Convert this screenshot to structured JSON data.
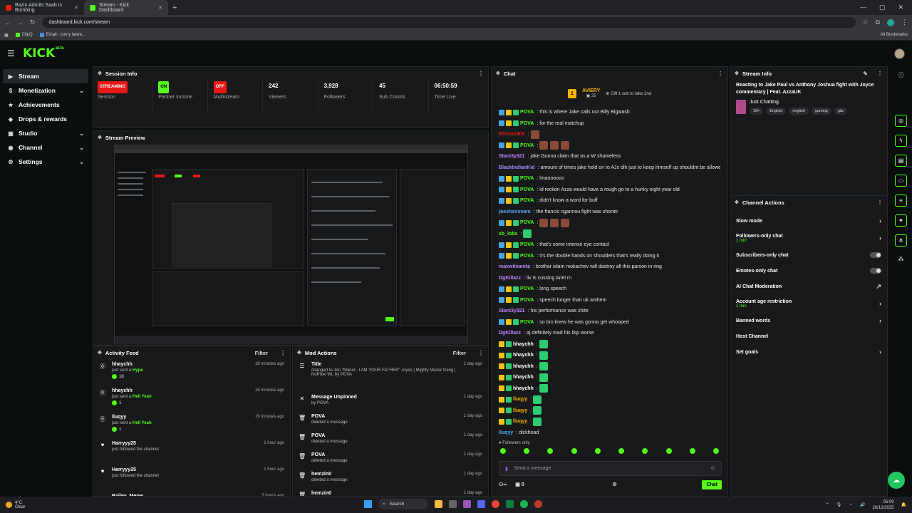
{
  "browser": {
    "tabs": [
      {
        "title": "Bazin Admits Saab Is Bombing",
        "color": "#e91916",
        "active": false
      },
      {
        "title": "Stream - Kick Dashboard",
        "color": "#53fc18",
        "active": true
      }
    ],
    "new_tab_label": "+",
    "url": "dashboard.kick.com/stream",
    "bookmarks": [
      {
        "label": "ClipQ",
        "color": "#53fc18"
      },
      {
        "label": "Email - jonny lawre...",
        "color": "#4a90d9"
      }
    ],
    "all_bookmarks_label": "All Bookmarks"
  },
  "header": {
    "logo": "KICK",
    "beta": "BETA"
  },
  "nav": {
    "items": [
      {
        "label": "Stream",
        "icon": "stream-icon",
        "glyph": "▶",
        "active": true,
        "chevron": false
      },
      {
        "label": "Monetization",
        "icon": "money-icon",
        "glyph": "$",
        "active": false,
        "chevron": true
      },
      {
        "label": "Achievements",
        "icon": "trophy-icon",
        "glyph": "★",
        "active": false,
        "chevron": false
      },
      {
        "label": "Drops & rewards",
        "icon": "gift-icon",
        "glyph": "◆",
        "active": false,
        "chevron": false
      },
      {
        "label": "Studio",
        "icon": "studio-icon",
        "glyph": "▣",
        "active": false,
        "chevron": true
      },
      {
        "label": "Channel",
        "icon": "channel-icon",
        "glyph": "◉",
        "active": false,
        "chevron": true
      },
      {
        "label": "Settings",
        "icon": "gear-icon",
        "glyph": "⚙",
        "active": false,
        "chevron": true
      }
    ]
  },
  "session": {
    "title": "Session Info",
    "cells": [
      {
        "value": "STREAMING",
        "label": "Session",
        "kind": "badge-red"
      },
      {
        "value": "ON",
        "label": "Partner Income",
        "kind": "badge-green"
      },
      {
        "value": "OFF",
        "label": "Multistream",
        "kind": "badge-red"
      },
      {
        "value": "242",
        "label": "Viewers",
        "kind": "text"
      },
      {
        "value": "3,928",
        "label": "Followers",
        "kind": "text"
      },
      {
        "value": "45",
        "label": "Sub Counts",
        "kind": "text"
      },
      {
        "value": "06:50:59",
        "label": "Time Live",
        "kind": "text"
      }
    ]
  },
  "preview": {
    "title": "Stream Preview"
  },
  "activity": {
    "title": "Activity Feed",
    "filter": "Filter",
    "items": [
      {
        "name": "hhaychh",
        "desc": "just sent a",
        "highlight": "Hype",
        "amount": "10",
        "time": "18 minutes ago",
        "icon": "kick-coin-icon",
        "glyph": "⓪"
      },
      {
        "name": "hhaychh",
        "desc": "just sent a",
        "highlight": "Hell Yeah",
        "amount": "1",
        "time": "18 minutes ago",
        "icon": "kick-coin-icon",
        "glyph": "⓪"
      },
      {
        "name": "lluqyy",
        "desc": "just sent a",
        "highlight": "Hell Yeah",
        "amount": "1",
        "time": "19 minutes ago",
        "icon": "kick-coin-icon",
        "glyph": "⓪"
      },
      {
        "name": "Harryyy25",
        "desc": "just followed the channel",
        "highlight": "",
        "amount": "",
        "time": "1 hour ago",
        "icon": "heart-icon",
        "glyph": "♥"
      },
      {
        "name": "Harryyy25",
        "desc": "just followed the channel",
        "highlight": "",
        "amount": "",
        "time": "1 hour ago",
        "icon": "heart-icon",
        "glyph": "♥"
      },
      {
        "name": "Bailey_Meow",
        "desc": "",
        "highlight": "",
        "amount": "",
        "time": "3 hours ago",
        "icon": "heart-icon",
        "glyph": "♥"
      }
    ]
  },
  "mod": {
    "title": "Mod Actions",
    "filter": "Filter",
    "items": [
      {
        "name": "Title",
        "desc": "changed to Jon \"Manor...I AM YOUR FATHER\" Joyce | Mighty Manor Gang | NoPixel WL by POVA",
        "time": "1 day ago",
        "icon": "title-icon",
        "glyph": "☰"
      },
      {
        "name": "Message Unpinned",
        "desc": "by POVA",
        "time": "1 day ago",
        "icon": "unpin-icon",
        "glyph": "✕"
      },
      {
        "name": "POVA",
        "desc": "deleted a message",
        "time": "1 day ago",
        "icon": "trash-icon",
        "glyph": "🗑"
      },
      {
        "name": "POVA",
        "desc": "deleted a message",
        "time": "1 day ago",
        "icon": "trash-icon",
        "glyph": "🗑"
      },
      {
        "name": "POVA",
        "desc": "deleted a message",
        "time": "1 day ago",
        "icon": "trash-icon",
        "glyph": "🗑"
      },
      {
        "name": "hemzin0",
        "desc": "deleted a message",
        "time": "1 day ago",
        "icon": "trash-icon",
        "glyph": "🗑"
      },
      {
        "name": "hemzin0",
        "desc": "",
        "time": "1 day ago",
        "icon": "trash-icon",
        "glyph": "🗑"
      }
    ]
  },
  "chat": {
    "title": "Chat",
    "pinned": {
      "rank": "1",
      "name": "AVIERY",
      "count": "25",
      "gift_text": "Gift 1 sub to take 2nd"
    },
    "messages": [
      {
        "user": "POVA",
        "color": "#53fc18",
        "badges": 3,
        "text": "this is where Jake calls out Billy Bigwash",
        "emotes": 0
      },
      {
        "user": "POVA",
        "color": "#53fc18",
        "badges": 3,
        "text": "for the real matchup",
        "emotes": 0
      },
      {
        "user": "67Gex1900",
        "color": "#e91916",
        "badges": 0,
        "text": "",
        "emotes": 1
      },
      {
        "user": "POVA",
        "color": "#53fc18",
        "badges": 3,
        "text": "",
        "emotes": 3
      },
      {
        "user": "Stani3y321",
        "color": "#c084fc",
        "badges": 0,
        "text": "jake Gunna claim that as a W shameless",
        "emotes": 0
      },
      {
        "user": "BlackIndianKid",
        "color": "#a78bfa",
        "badges": 0,
        "text": "amount of times jake held on to AJs dih just to keep himself up shouldnt be allowed",
        "emotes": 0
      },
      {
        "user": "POVA",
        "color": "#53fc18",
        "badges": 3,
        "text": "lmaoooooo",
        "emotes": 0
      },
      {
        "user": "POVA",
        "color": "#53fc18",
        "badges": 3,
        "text": "id reckon Azza would have a rough go to a hunky eight year old",
        "emotes": 0
      },
      {
        "user": "POVA",
        "color": "#53fc18",
        "badges": 3,
        "text": "didn't know a word for buff",
        "emotes": 0
      },
      {
        "user": "joeshsnsnam",
        "color": "#60a5fa",
        "badges": 0,
        "text": "the francis ngannou fight was shorter",
        "emotes": 0
      },
      {
        "user": "POVA",
        "color": "#53fc18",
        "badges": 3,
        "text": "",
        "emotes": 3
      },
      {
        "user": "sb_lobs",
        "color": "#53fc18",
        "badges": 0,
        "text": "",
        "emotes": 1
      },
      {
        "user": "POVA",
        "color": "#53fc18",
        "badges": 3,
        "text": "that's some intense eye contact",
        "emotes": 0
      },
      {
        "user": "POVA",
        "color": "#53fc18",
        "badges": 3,
        "text": "it's the double hands on shoulders that's really doing it",
        "emotes": 0
      },
      {
        "user": "maxwilnanita",
        "color": "#c084fc",
        "badges": 0,
        "text": "brothar islam mokachev will dastroy all this parson in ring",
        "emotes": 0
      },
      {
        "user": "DgKillazz",
        "color": "#c084fc",
        "badges": 0,
        "text": "liv is cussing Ariel rn",
        "emotes": 0
      },
      {
        "user": "POVA",
        "color": "#53fc18",
        "badges": 3,
        "text": "long speech",
        "emotes": 0
      },
      {
        "user": "POVA",
        "color": "#53fc18",
        "badges": 3,
        "text": "speech longer than uk anthem",
        "emotes": 0
      },
      {
        "user": "Stani3y321",
        "color": "#c084fc",
        "badges": 0,
        "text": "his performance was shite",
        "emotes": 0
      },
      {
        "user": "POVA",
        "color": "#53fc18",
        "badges": 3,
        "text": "so bro knew he was gonna get whooped",
        "emotes": 0
      },
      {
        "user": "DgKillazz",
        "color": "#c084fc",
        "badges": 0,
        "text": "aj definitely mad his lisp worse",
        "emotes": 0
      },
      {
        "user": "hhaychh",
        "color": "#ffffff",
        "badges": 2,
        "text": "",
        "emotes": 1
      },
      {
        "user": "hhaychh",
        "color": "#ffffff",
        "badges": 2,
        "text": "",
        "emotes": 1
      },
      {
        "user": "hhaychh",
        "color": "#ffffff",
        "badges": 2,
        "text": "",
        "emotes": 1
      },
      {
        "user": "hhaychh",
        "color": "#ffffff",
        "badges": 2,
        "text": "",
        "emotes": 1
      },
      {
        "user": "hhaychh",
        "color": "#ffffff",
        "badges": 2,
        "text": "",
        "emotes": 1
      },
      {
        "user": "lluqyy",
        "color": "#f4b400",
        "badges": 2,
        "text": "",
        "emotes": 1
      },
      {
        "user": "lluqyy",
        "color": "#f4b400",
        "badges": 2,
        "text": "",
        "emotes": 1
      },
      {
        "user": "lluqyy",
        "color": "#f4b400",
        "badges": 2,
        "text": "",
        "emotes": 1
      },
      {
        "user": "lluqyy",
        "color": "#60a5fa",
        "badges": 0,
        "text": "dickhead",
        "emotes": 0
      }
    ],
    "followers_only": "♥ Followers only",
    "input_placeholder": "Send a message",
    "viewers_count": "0",
    "send_label": "Chat"
  },
  "stream_info": {
    "title": "Stream Info",
    "stream_title": "Reacting to Jake Paul vs Anthony Joshua fight with Joyce commentary | Feat. AzzaUK",
    "category": "Just Chatting",
    "tags": [
      "18+",
      "English",
      "english",
      "gaming",
      "gta"
    ]
  },
  "channel_actions": {
    "title": "Channel Actions",
    "items": [
      {
        "label": "Slow mode",
        "sub": "",
        "control": "chevron"
      },
      {
        "label": "Followers-only chat",
        "sub": "1 min",
        "control": "chevron"
      },
      {
        "label": "Subscribers-only chat",
        "sub": "",
        "control": "toggle"
      },
      {
        "label": "Emotes-only chat",
        "sub": "",
        "control": "toggle"
      },
      {
        "label": "AI Chat Moderation",
        "sub": "",
        "control": "external"
      },
      {
        "label": "Account age restriction",
        "sub": "1 min",
        "control": "chevron"
      },
      {
        "label": "Banned words",
        "sub": "",
        "control": "chevron"
      },
      {
        "label": "Host Channel",
        "sub": "",
        "control": "none"
      },
      {
        "label": "Set goals",
        "sub": "",
        "control": "chevron"
      }
    ]
  },
  "taskbar": {
    "temp": "4°C",
    "weather": "Clear",
    "search": "Search",
    "time": "05:09",
    "date": "20/12/2025"
  },
  "colors": {
    "accent": "#53fc18",
    "danger": "#e91916",
    "panel": "#18191b"
  }
}
